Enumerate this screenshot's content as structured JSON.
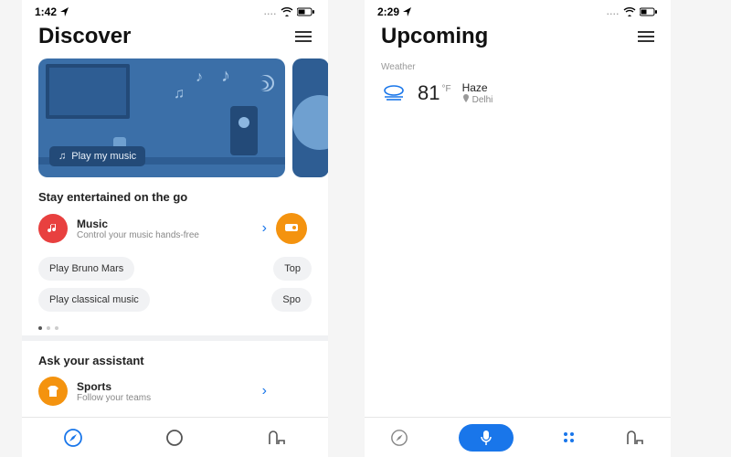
{
  "left": {
    "status": {
      "time": "1:42",
      "icons": {
        "location": "location-icon",
        "dots": "....",
        "wifi": "wifi-icon",
        "battery": "battery-icon"
      }
    },
    "title": "Discover",
    "hero": {
      "chip_label": "Play my music"
    },
    "section1": {
      "heading": "Stay entertained on the go",
      "tile": {
        "title": "Music",
        "subtitle": "Control your music hands-free"
      },
      "chips": {
        "a": "Play Bruno Mars",
        "b": "Play classical music",
        "c": "Top",
        "d": "Spo"
      }
    },
    "section2": {
      "heading": "Ask your assistant",
      "tile": {
        "title": "Sports",
        "subtitle": "Follow your teams"
      }
    },
    "nav": {
      "a": "compass-icon",
      "b": "circle-icon",
      "c": "headset-icon"
    }
  },
  "right": {
    "status": {
      "time": "2:29",
      "icons": {
        "location": "location-icon",
        "dots": "....",
        "wifi": "wifi-icon",
        "battery": "battery-icon"
      }
    },
    "title": "Upcoming",
    "weather": {
      "label": "Weather",
      "temp": "81",
      "unit": "°F",
      "condition": "Haze",
      "location": "Delhi"
    },
    "nav": {
      "a": "compass-icon",
      "b": "mic-icon",
      "c": "grid-icon",
      "d": "headset-icon"
    }
  },
  "colors": {
    "accent": "#1976ea",
    "music_icon_bg": "#e8403f",
    "orange": "#f4930f"
  }
}
